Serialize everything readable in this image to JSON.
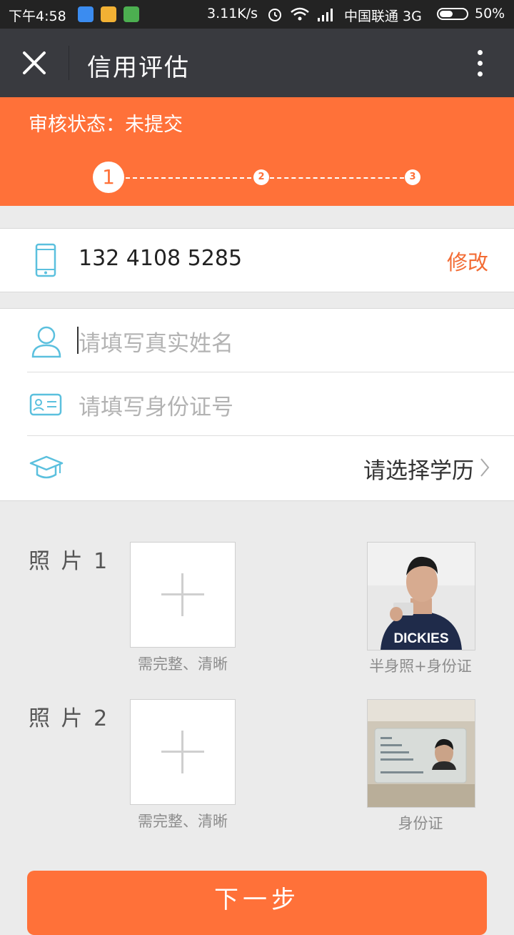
{
  "statusbar": {
    "time": "下午4:58",
    "net_speed": "3.11K/s",
    "carrier": "中国联通 3G",
    "battery": "50%"
  },
  "titlebar": {
    "title": "信用评估"
  },
  "header": {
    "status_text": "审核状态：未提交",
    "steps": [
      "1",
      "2",
      "3"
    ],
    "current_step": 1
  },
  "phone": {
    "number": "132 4108 5285",
    "edit_label": "修改"
  },
  "form": {
    "name_placeholder": "请填写真实姓名",
    "id_placeholder": "请填写身份证号",
    "education_select": "请选择学历"
  },
  "photos": [
    {
      "label": "照 片 1",
      "upload_caption": "需完整、清晰",
      "sample_caption": "半身照+身份证"
    },
    {
      "label": "照 片 2",
      "upload_caption": "需完整、清晰",
      "sample_caption": "身份证"
    }
  ],
  "next_button": "下一步",
  "colors": {
    "accent": "#ff7139",
    "titlebar": "#393a3f",
    "statusbar": "#232323",
    "background": "#ebebeb"
  }
}
